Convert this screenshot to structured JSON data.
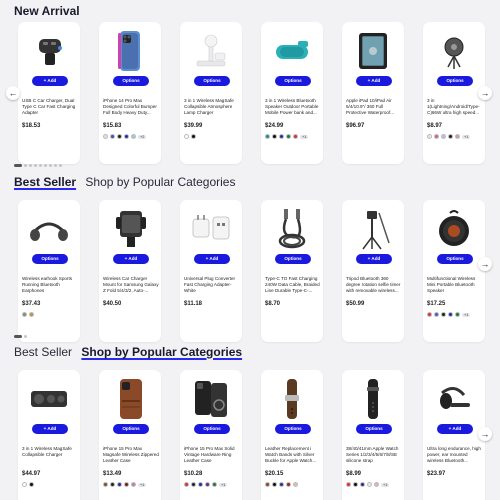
{
  "sections": [
    {
      "title_primary": "New Arrival",
      "title_secondary": "",
      "products": [
        {
          "title": "USB C Car Charger, Dual Type C Car Fast Charging Adapter",
          "price": "$18.53",
          "button": "Add",
          "icon": "car-charger-icon",
          "swatches": []
        },
        {
          "title": "iPhone 14 Pro Max Designed Colorful Bumper Full Body Heavy Duty...",
          "price": "$15.83",
          "button": "Options",
          "icon": "phone-case-icon",
          "swatches": [
            "#e0e0e0",
            "#3b5ba8",
            "#222222",
            "#2a2aa0",
            "#9acde0"
          ],
          "more": "+2"
        },
        {
          "title": "3 in 1 Wireless MagSafe Collapsible Atmosphere Lamp Charger",
          "price": "$39.99",
          "button": "Options",
          "icon": "magsafe-stand-icon",
          "swatches": [
            "#ffffff",
            "#111111"
          ]
        },
        {
          "title": "3 in 1 Wireless Bluetooth Speaker Outdoor Portable Mobile Power bank and...",
          "price": "$24.99",
          "button": "Options",
          "icon": "speaker-icon",
          "swatches": [
            "#1a8f8f",
            "#111111",
            "#2a2aa0",
            "#1e7a3a",
            "#e03030"
          ],
          "more": "+1"
        },
        {
          "title": "Apple iPad 10/iPad Air 5/4/10.9\"/ 360 Full Protective Waterproof...",
          "price": "$96.97",
          "button": "Add",
          "icon": "tablet-case-icon",
          "swatches": []
        },
        {
          "title": "3 in 1(Lightning/Android/Type-C)66W ultra high speed...",
          "price": "$8.97",
          "button": "Options",
          "icon": "cable-reel-icon",
          "swatches": [
            "#e8e8e8",
            "#e06080",
            "#c8b8e8",
            "#222222",
            "#c8a0a0"
          ],
          "more": "+1"
        }
      ]
    },
    {
      "title_primary": "Best Seller",
      "title_secondary": "Shop by Popular Categories",
      "products": [
        {
          "title": "Wireless earhook Sports Running Bluetooth Earphones",
          "price": "$37.43",
          "button": "Options",
          "icon": "earphones-icon",
          "swatches": [
            "#888888",
            "#c89040"
          ]
        },
        {
          "title": "Wireless Car Charger Mount for Samsung Galaxy Z Fold 5/4/3/2, Auto-...",
          "price": "$40.50",
          "button": "Add",
          "icon": "car-mount-icon",
          "swatches": []
        },
        {
          "title": "Universal Plug Converter Fast Charging Adapter-White",
          "price": "$11.18",
          "button": "Add",
          "icon": "plug-adapter-icon",
          "swatches": []
        },
        {
          "title": "Type-C TO Fast Charging 240W Data Cable, Braided Line Durable Type-C-...",
          "price": "$8.70",
          "button": "Options",
          "icon": "usb-cable-icon",
          "swatches": []
        },
        {
          "title": "Tripod Bluetooth 360 degree rotation selfie timer with removable wireless...",
          "price": "$50.99",
          "button": "Add",
          "icon": "selfie-tripod-icon",
          "swatches": []
        },
        {
          "title": "Multifunctional Wireless Mini Portable Bluetooth Speaker",
          "price": "$17.25",
          "button": "Options",
          "icon": "mini-speaker-icon",
          "swatches": [
            "#e03030",
            "#3a5fd0",
            "#222222",
            "#2a2aa0",
            "#1e7a3a"
          ],
          "more": "+1"
        }
      ]
    },
    {
      "title_primary": "Best Seller",
      "title_secondary": "Shop by Popular Categories",
      "products": [
        {
          "title": "3 in 1 Wireless MagSafe Collapsible Charger",
          "price": "$44.97",
          "button": "Add",
          "icon": "foldable-charger-icon",
          "swatches": [
            "#ffffff",
            "#111111"
          ]
        },
        {
          "title": "iPhone 15 Pro Max Magsafe Wireless Zippered Leather Case",
          "price": "$13.49",
          "button": "Options",
          "icon": "leather-case-icon",
          "swatches": [
            "#8a4a2a",
            "#222222",
            "#2a2aa0",
            "#7a1a1a",
            "#c080a0"
          ],
          "more": "+1"
        },
        {
          "title": "iPhone 15 Pro Max Solid Vintage Hardware Ring Leather Case",
          "price": "$10.28",
          "button": "Options",
          "icon": "ring-case-icon",
          "swatches": [
            "#e03030",
            "#222222",
            "#2a2aa0",
            "#6a2a7a",
            "#1e7a3a"
          ],
          "more": "+1"
        },
        {
          "title": "Leather Replacement i Watch Bands with Silver Buckle for Apple Watch...",
          "price": "$20.15",
          "button": "Options",
          "icon": "watch-band-icon",
          "swatches": [
            "#8a4a2a",
            "#111111",
            "#2a2aa0",
            "#a02020",
            "#e0b8c0"
          ]
        },
        {
          "title": "38/40/41mm Apple Watch Series 1/2/3/4/5/6/7/8/SE silicone strap",
          "price": "$8.99",
          "button": "Options",
          "icon": "silicone-strap-icon",
          "swatches": [
            "#e03030",
            "#111111",
            "#2a2aa0",
            "#e8e8e8",
            "#e0b0c8"
          ],
          "more": "+1"
        },
        {
          "title": "Ultra long endurance, high power, ear mounted wireless Bluetooth...",
          "price": "$23.97",
          "button": "Add",
          "icon": "bluetooth-headset-icon",
          "swatches": []
        }
      ]
    }
  ]
}
